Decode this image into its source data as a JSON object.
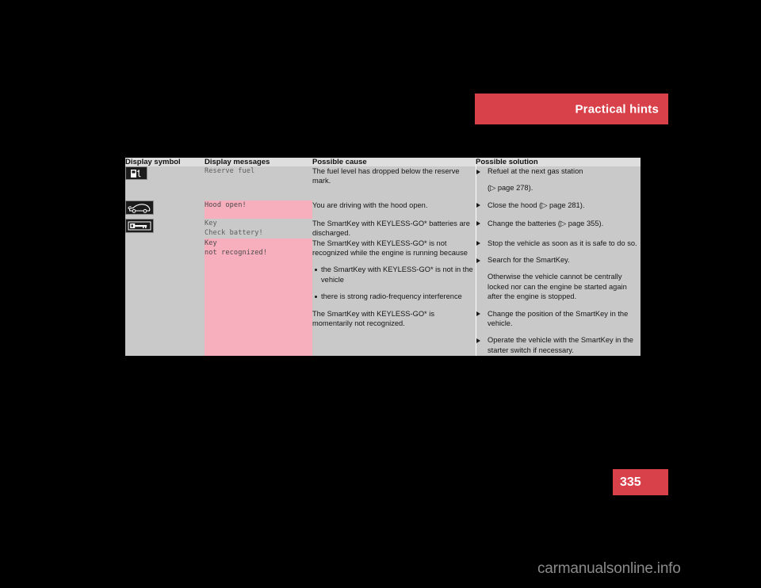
{
  "header": {
    "section_title": "Practical hints",
    "banner_color": "#d8404a"
  },
  "page": {
    "number": "335",
    "tab_color": "#d8404a",
    "watermark": "carmanualsonline.info"
  },
  "table": {
    "columns": [
      {
        "label": "Display symbol"
      },
      {
        "label": "Display messages"
      },
      {
        "label": "Possible cause"
      },
      {
        "label": "Possible solution"
      }
    ],
    "rows": [
      {
        "symbol_icon": "fuel-pump-icon",
        "message": "Reserve fuel",
        "message_highlight": false,
        "cause": "The fuel level has dropped below the reserve mark.",
        "solutions": [
          {
            "type": "arrow",
            "text": "Refuel at the next gas station"
          },
          {
            "type": "plain",
            "text": "(▷ page 278)."
          }
        ]
      },
      {
        "symbol_icon": "car-hood-open-icon",
        "message": "Hood open!",
        "message_highlight": true,
        "cause": "You are driving with the hood open.",
        "solutions": [
          {
            "type": "arrow",
            "text": "Close the hood (▷ page 281)."
          }
        ]
      },
      {
        "symbol_icon": "smartkey-icon",
        "message": "Key\nCheck battery!",
        "message_highlight": false,
        "cause": "The SmartKey with KEYLESS-GO* batteries are discharged.",
        "solutions": [
          {
            "type": "arrow",
            "text": "Change the batteries (▷ page 355)."
          }
        ]
      },
      {
        "symbol_icon": "",
        "message": "Key\nnot recognized!",
        "message_highlight": true,
        "cause": "The SmartKey with KEYLESS-GO* is not recognized while the engine is running because",
        "cause_bullets": [
          "the SmartKey with KEYLESS-GO* is not in the vehicle",
          "there is strong radio-frequency interference"
        ],
        "solutions": [
          {
            "type": "arrow",
            "text": "Stop the vehicle as soon as it is safe to do so."
          },
          {
            "type": "arrow",
            "text": "Search for the SmartKey."
          },
          {
            "type": "plain",
            "text": "Otherwise the vehicle cannot be centrally locked nor can the engine be started again after the engine is stopped."
          }
        ]
      },
      {
        "symbol_icon": "",
        "message": "",
        "message_highlight": true,
        "cause": "The SmartKey with KEYLESS-GO* is momentarily not recognized.",
        "solutions": [
          {
            "type": "arrow",
            "text": "Change the position of the SmartKey in the vehicle."
          },
          {
            "type": "arrow",
            "text": "Operate the vehicle with the SmartKey in the starter switch if necessary."
          }
        ]
      }
    ]
  },
  "colors": {
    "table_bg": "#c9c9c9",
    "header_bg": "#dedede",
    "highlight_pink": "#f7aebd",
    "page_bg": "#000000"
  }
}
